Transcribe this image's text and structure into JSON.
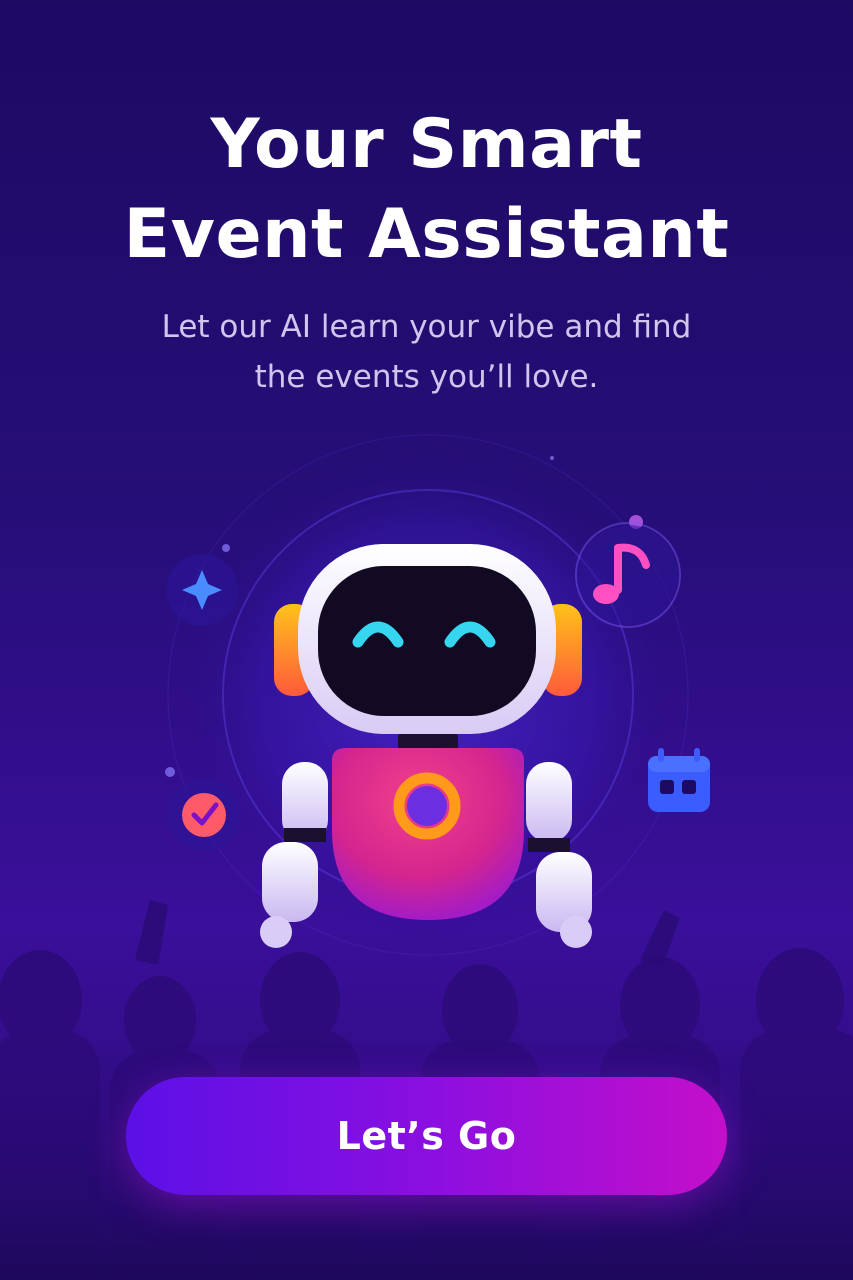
{
  "onboarding": {
    "title_line1": "Your Smart",
    "title_line2": "Event Assistant",
    "subtitle_line1": "Let our AI learn your vibe and find",
    "subtitle_line2": "the events you’ll love.",
    "cta_label": "Let’s Go"
  },
  "colors": {
    "background": "#220c6e",
    "accent": "#8a0fe0",
    "cta_start": "#5b10e6",
    "cta_end": "#c40fca",
    "robot_body": "#e0337f",
    "robot_eyes": "#36d6f0"
  },
  "icons": [
    "sparkle-icon",
    "music-note-icon",
    "calendar-icon",
    "check-badge-icon",
    "robot-mascot"
  ]
}
